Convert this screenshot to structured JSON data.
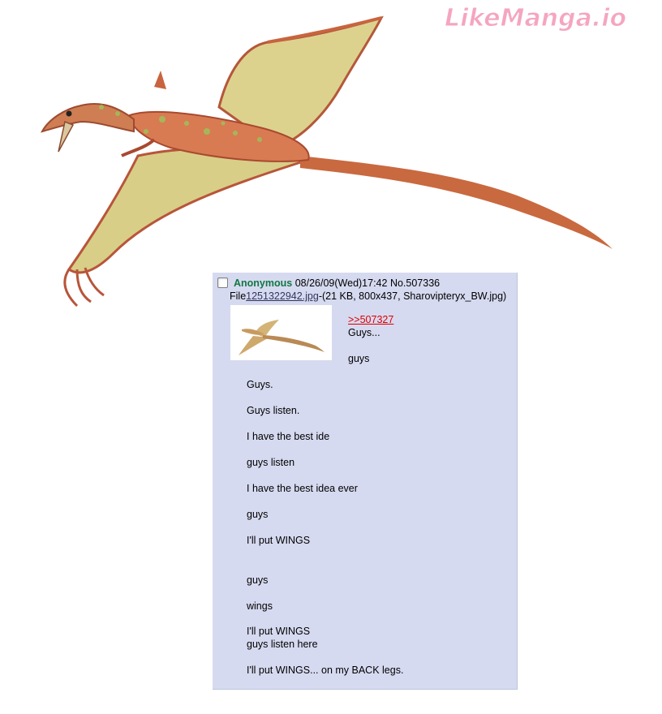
{
  "watermark": {
    "text": "LikeManga.io"
  },
  "post": {
    "name": "Anonymous",
    "datetime": "08/26/09(Wed)17:42",
    "number": "No.507336",
    "file_prefix": "File",
    "file_name": "1251322942.jpg",
    "file_info": "-(21 KB, 800x437, Sharovipteryx_BW.jpg)",
    "quote": ">>507327",
    "lines": [
      "Guys...",
      "guys",
      "Guys.",
      "Guys listen.",
      "I have the best ide",
      "guys listen",
      "I have the best idea ever",
      "guys",
      "I'll put WINGS",
      "guys",
      "wings",
      "I'll put WINGS",
      "guys listen here",
      "I'll put WINGS... on my BACK legs."
    ]
  },
  "colors": {
    "post_bg": "#d6daf0",
    "name": "#117743",
    "quote": "#dd0000",
    "link": "#34345c"
  }
}
